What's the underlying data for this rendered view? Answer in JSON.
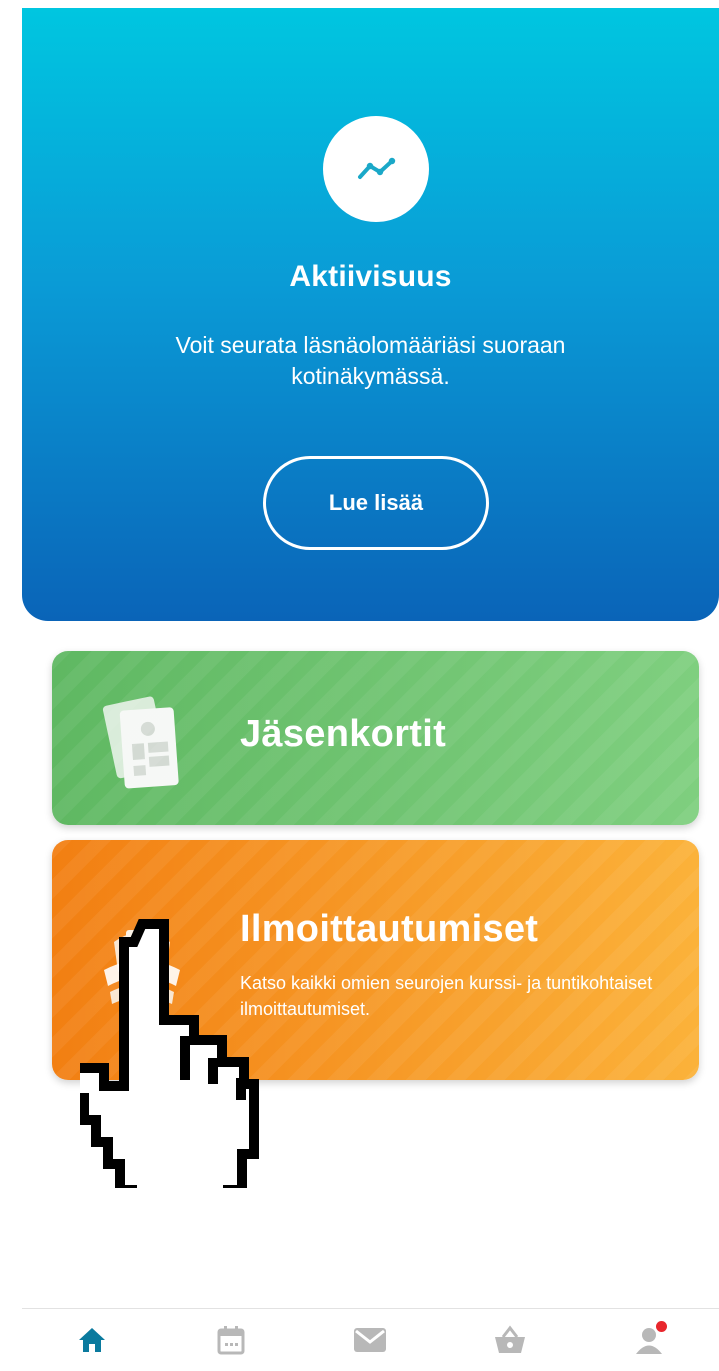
{
  "hero": {
    "icon": "activity-trend-icon",
    "title": "Aktiivisuus",
    "description": "Voit seurata läsnäolomääriäsi suoraan kotinäkymässä.",
    "button_label": "Lue lisää"
  },
  "tiles": [
    {
      "icon": "member-card-icon",
      "title": "Jäsenkortit",
      "color": "#6cc46e"
    },
    {
      "icon": "registrations-icon",
      "title": "Ilmoittautumiset",
      "subtitle": "Katso kaikki omien seurojen kurssi- ja tuntikohtaiset ilmoittautumiset.",
      "color": "#f7931e"
    }
  ],
  "bottom_nav": {
    "items": [
      {
        "icon": "home-icon",
        "active": true
      },
      {
        "icon": "calendar-icon",
        "active": false
      },
      {
        "icon": "mail-icon",
        "active": false
      },
      {
        "icon": "basket-icon",
        "active": false
      },
      {
        "icon": "profile-icon",
        "active": false,
        "badge": true
      }
    ],
    "active_color": "#0a7a9e",
    "inactive_color": "#b8b8b8",
    "badge_color": "#e8262c"
  },
  "colors": {
    "hero_top": "#00c6e0",
    "hero_bottom": "#0a64b8",
    "accent_icon": "#1aa8c8"
  }
}
